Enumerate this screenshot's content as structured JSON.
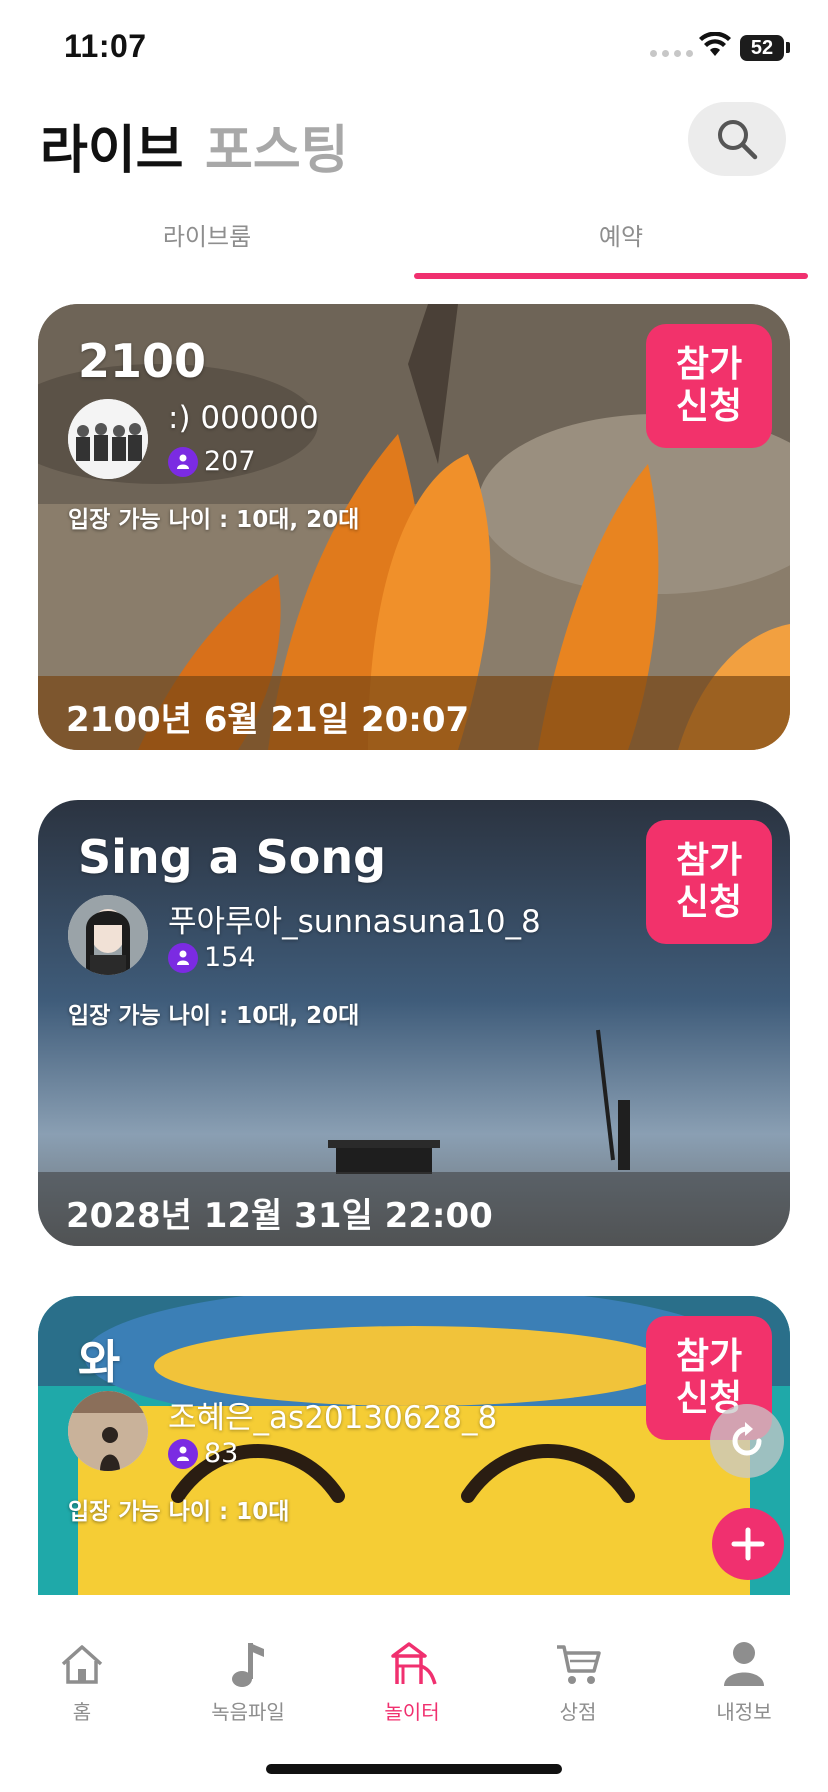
{
  "status_bar": {
    "time": "11:07",
    "battery": "52"
  },
  "header": {
    "tab_live": "라이브",
    "tab_posting": "포스팅"
  },
  "subtabs": {
    "first": "라이브룸",
    "second": "예약"
  },
  "cards": [
    {
      "title": "2100",
      "host": ":) 000000",
      "count": "207",
      "age": "입장 가능 나이 : 10대, 20대",
      "date": "2100년 6월 21일 20:07",
      "join_line1": "참가",
      "join_line2": "신청"
    },
    {
      "title": "Sing a Song",
      "host": "푸아루아_sunnasuna10_8",
      "count": "154",
      "age": "입장 가능 나이 : 10대, 20대",
      "date": "2028년 12월 31일 22:00",
      "join_line1": "참가",
      "join_line2": "신청"
    },
    {
      "title": "와",
      "host": "조혜은_as20130628_8",
      "count": "83",
      "age": "입장 가능 나이 : 10대",
      "date": "",
      "join_line1": "참가",
      "join_line2": "신청"
    }
  ],
  "tabbar": [
    {
      "label": "홈",
      "icon": "home-icon"
    },
    {
      "label": "녹음파일",
      "icon": "music-note-icon"
    },
    {
      "label": "놀이터",
      "icon": "playground-icon"
    },
    {
      "label": "상점",
      "icon": "cart-icon"
    },
    {
      "label": "내정보",
      "icon": "person-icon"
    }
  ],
  "colors": {
    "accent": "#f0306f",
    "people_badge": "#7b2be2"
  }
}
